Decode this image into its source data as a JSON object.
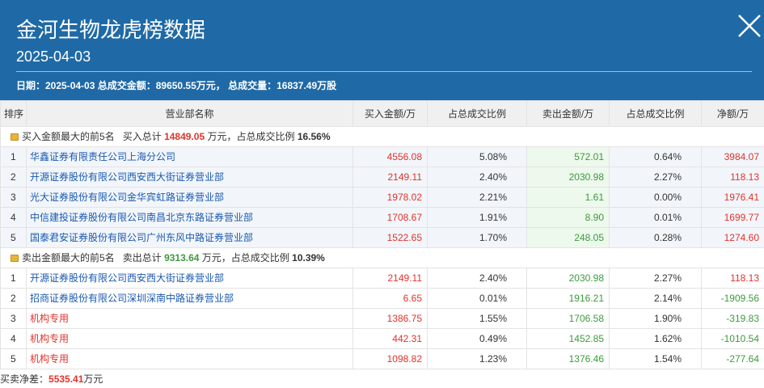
{
  "header": {
    "title": "金河生物龙虎榜数据",
    "date": "2025-04-03",
    "summary": "日期：2025-04-03 总成交金额：89650.55万元， 总成交量：16837.49万股"
  },
  "colors": {
    "header_bg": "#1f6aa6",
    "red": "#e0332b",
    "green": "#3c9a3c",
    "link": "#1a59b0"
  },
  "columns": [
    "排序",
    "营业部名称",
    "买入金额/万",
    "占总成交比例",
    "卖出金额/万",
    "占总成交比例",
    "净额/万"
  ],
  "buy_group": {
    "label_pre": "买入金额最大的前5名",
    "total_pre": "买入总计",
    "total_value": "14849.05",
    "total_post": "万元，占总成交比例",
    "ratio": "16.56%",
    "rows": [
      {
        "rank": "1",
        "name": "华鑫证券有限责任公司上海分公司",
        "buy": "4556.08",
        "buy_pct": "5.08%",
        "sell": "572.01",
        "sell_pct": "0.64%",
        "net": "3984.07"
      },
      {
        "rank": "2",
        "name": "开源证券股份有限公司西安西大街证券营业部",
        "buy": "2149.11",
        "buy_pct": "2.40%",
        "sell": "2030.98",
        "sell_pct": "2.27%",
        "net": "118.13"
      },
      {
        "rank": "3",
        "name": "光大证券股份有限公司金华宾虹路证券营业部",
        "buy": "1978.02",
        "buy_pct": "2.21%",
        "sell": "1.61",
        "sell_pct": "0.00%",
        "net": "1976.41"
      },
      {
        "rank": "4",
        "name": "中信建投证券股份有限公司南昌北京东路证券营业部",
        "buy": "1708.67",
        "buy_pct": "1.91%",
        "sell": "8.90",
        "sell_pct": "0.01%",
        "net": "1699.77"
      },
      {
        "rank": "5",
        "name": "国泰君安证券股份有限公司广州东风中路证券营业部",
        "buy": "1522.65",
        "buy_pct": "1.70%",
        "sell": "248.05",
        "sell_pct": "0.28%",
        "net": "1274.60"
      }
    ]
  },
  "sell_group": {
    "label_pre": "卖出金额最大的前5名",
    "total_pre": "卖出总计",
    "total_value": "9313.64",
    "total_post": "万元，占总成交比例",
    "ratio": "10.39%",
    "rows": [
      {
        "rank": "1",
        "name": "开源证券股份有限公司西安西大街证券营业部",
        "buy": "2149.11",
        "buy_pct": "2.40%",
        "sell": "2030.98",
        "sell_pct": "2.27%",
        "net": "118.13"
      },
      {
        "rank": "2",
        "name": "招商证券股份有限公司深圳深南中路证券营业部",
        "buy": "6.65",
        "buy_pct": "0.01%",
        "sell": "1916.21",
        "sell_pct": "2.14%",
        "net": "-1909.56"
      },
      {
        "rank": "3",
        "name": "机构专用",
        "buy": "1386.75",
        "buy_pct": "1.55%",
        "sell": "1706.58",
        "sell_pct": "1.90%",
        "net": "-319.83"
      },
      {
        "rank": "4",
        "name": "机构专用",
        "buy": "442.31",
        "buy_pct": "0.49%",
        "sell": "1452.85",
        "sell_pct": "1.62%",
        "net": "-1010.54"
      },
      {
        "rank": "5",
        "name": "机构专用",
        "buy": "1098.82",
        "buy_pct": "1.23%",
        "sell": "1376.46",
        "sell_pct": "1.54%",
        "net": "-277.64"
      }
    ]
  },
  "footer": {
    "label": "买卖净差：",
    "value": "5535.41",
    "unit": "万元"
  }
}
